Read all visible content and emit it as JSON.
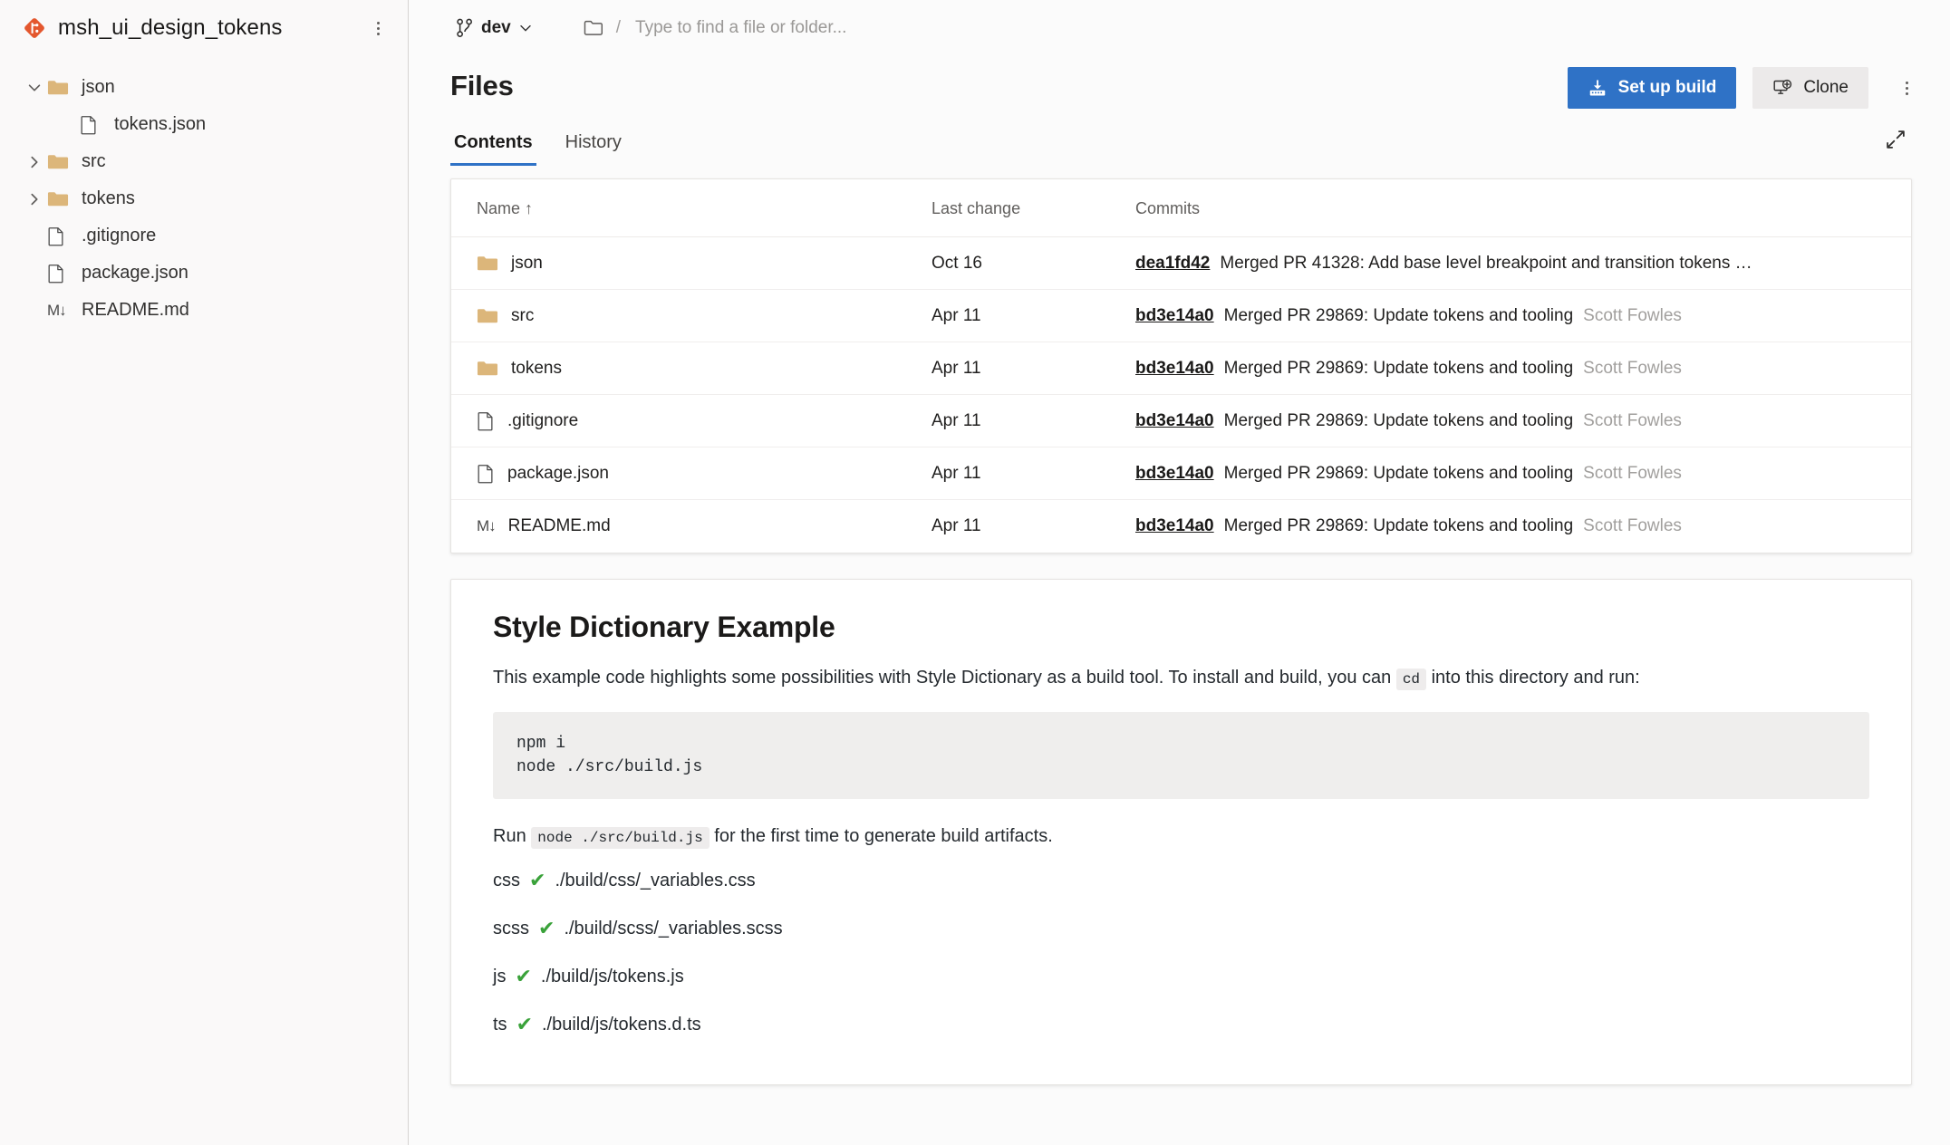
{
  "sidebar": {
    "repo_name": "msh_ui_design_tokens",
    "repo_icon": "git-repository-icon",
    "more_icon": "more-options-icon",
    "tree": [
      {
        "label": "json",
        "type": "folder",
        "indent": 1,
        "expanded": true,
        "chevron": "chevron-down-icon"
      },
      {
        "label": "tokens.json",
        "type": "file",
        "indent": 2,
        "expanded": null,
        "chevron": ""
      },
      {
        "label": "src",
        "type": "folder",
        "indent": 1,
        "expanded": false,
        "chevron": "chevron-right-icon"
      },
      {
        "label": "tokens",
        "type": "folder",
        "indent": 1,
        "expanded": false,
        "chevron": "chevron-right-icon"
      },
      {
        "label": ".gitignore",
        "type": "file",
        "indent": 1,
        "expanded": null,
        "chevron": ""
      },
      {
        "label": "package.json",
        "type": "file",
        "indent": 1,
        "expanded": null,
        "chevron": ""
      },
      {
        "label": "README.md",
        "type": "markdown",
        "indent": 1,
        "expanded": null,
        "chevron": ""
      }
    ]
  },
  "topbar": {
    "branch_name": "dev",
    "branch_icon": "branch-icon",
    "branch_chevron": "chevron-down-icon",
    "folder_icon": "folder-icon",
    "separator": "/",
    "find_placeholder": "Type to find a file or folder..."
  },
  "header": {
    "title": "Files",
    "setup_build_label": "Set up build",
    "setup_build_icon": "build-icon",
    "clone_label": "Clone",
    "clone_icon": "clone-icon",
    "more_icon": "more-options-icon"
  },
  "tabs": [
    {
      "label": "Contents",
      "active": true
    },
    {
      "label": "History",
      "active": false
    }
  ],
  "expand_icon": "expand-icon",
  "files_table": {
    "columns": [
      "Name ↑",
      "Last change",
      "Commits"
    ],
    "sort_indicator": "↑",
    "rows": [
      {
        "name": "json",
        "type": "folder",
        "last_change": "Oct 16",
        "commit_hash": "dea1fd42",
        "commit_message": "Merged PR 41328: Add base level breakpoint and transition tokens …",
        "author": ""
      },
      {
        "name": "src",
        "type": "folder",
        "last_change": "Apr 11",
        "commit_hash": "bd3e14a0",
        "commit_message": "Merged PR 29869: Update tokens and tooling",
        "author": "Scott Fowles"
      },
      {
        "name": "tokens",
        "type": "folder",
        "last_change": "Apr 11",
        "commit_hash": "bd3e14a0",
        "commit_message": "Merged PR 29869: Update tokens and tooling",
        "author": "Scott Fowles"
      },
      {
        "name": ".gitignore",
        "type": "file",
        "last_change": "Apr 11",
        "commit_hash": "bd3e14a0",
        "commit_message": "Merged PR 29869: Update tokens and tooling",
        "author": "Scott Fowles"
      },
      {
        "name": "package.json",
        "type": "file",
        "last_change": "Apr 11",
        "commit_hash": "bd3e14a0",
        "commit_message": "Merged PR 29869: Update tokens and tooling",
        "author": "Scott Fowles"
      },
      {
        "name": "README.md",
        "type": "markdown",
        "last_change": "Apr 11",
        "commit_hash": "bd3e14a0",
        "commit_message": "Merged PR 29869: Update tokens and tooling",
        "author": "Scott Fowles"
      }
    ]
  },
  "readme": {
    "heading": "Style Dictionary Example",
    "intro_part1": "This example code highlights some possibilities with Style Dictionary as a build tool. To install and build, you can",
    "intro_code": "cd",
    "intro_part2": "into this directory and run:",
    "code_block": "npm i\nnode ./src/build.js",
    "run_prefix": "Run",
    "run_code": "node ./src/build.js",
    "run_suffix": "for the first time to generate build artifacts.",
    "outputs": [
      {
        "label": "css",
        "check": "✔",
        "path": "./build/css/_variables.css"
      },
      {
        "label": "scss",
        "check": "✔",
        "path": "./build/scss/_variables.scss"
      },
      {
        "label": "js",
        "check": "✔",
        "path": "./build/js/tokens.js"
      },
      {
        "label": "ts",
        "check": "✔",
        "path": "./build/js/tokens.d.ts"
      }
    ]
  },
  "colors": {
    "accent": "#2f72c6",
    "repo_logo": "#e4572e",
    "folder": "#dcb67a",
    "check_green": "#3aa23a",
    "sidebar_bg": "#faf9f9"
  }
}
